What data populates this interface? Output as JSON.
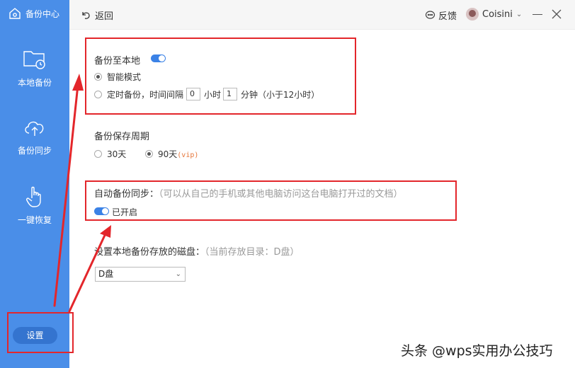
{
  "sidebar": {
    "brand": "备份中心",
    "items": [
      {
        "label": "本地备份",
        "icon": "folder-clock-icon"
      },
      {
        "label": "备份同步",
        "icon": "cloud-upload-icon"
      },
      {
        "label": "一键恢复",
        "icon": "hand-pointer-icon"
      }
    ],
    "settings_label": "设置"
  },
  "topbar": {
    "back_label": "返回",
    "feedback_label": "反馈",
    "user_name": "Coisini"
  },
  "local_backup": {
    "title": "备份至本地",
    "enabled": true,
    "smart_mode_label": "智能模式",
    "timed_prefix": "定时备份，时间间隔",
    "hours_value": "0",
    "hours_unit": "小时",
    "minutes_value": "1",
    "minutes_unit": "分钟（小于12小时）"
  },
  "retention": {
    "title": "备份保存周期",
    "option_30": "30天",
    "option_90": "90天",
    "vip_tag": "(vip)",
    "selected": "90天"
  },
  "auto_sync": {
    "title": "自动备份同步：",
    "hint": "（可以从自己的手机或其他电脑访问这台电脑打开过的文档）",
    "status_label": "已开启",
    "enabled": true
  },
  "disk": {
    "title": "设置本地备份存放的磁盘：",
    "hint": "（当前存放目录：D盘）",
    "selected": "D盘"
  },
  "watermark": "头条 @wps实用办公技巧",
  "colors": {
    "sidebar": "#4a8ee8",
    "accent": "#3b82e6",
    "annotation_red": "#e3262b"
  }
}
